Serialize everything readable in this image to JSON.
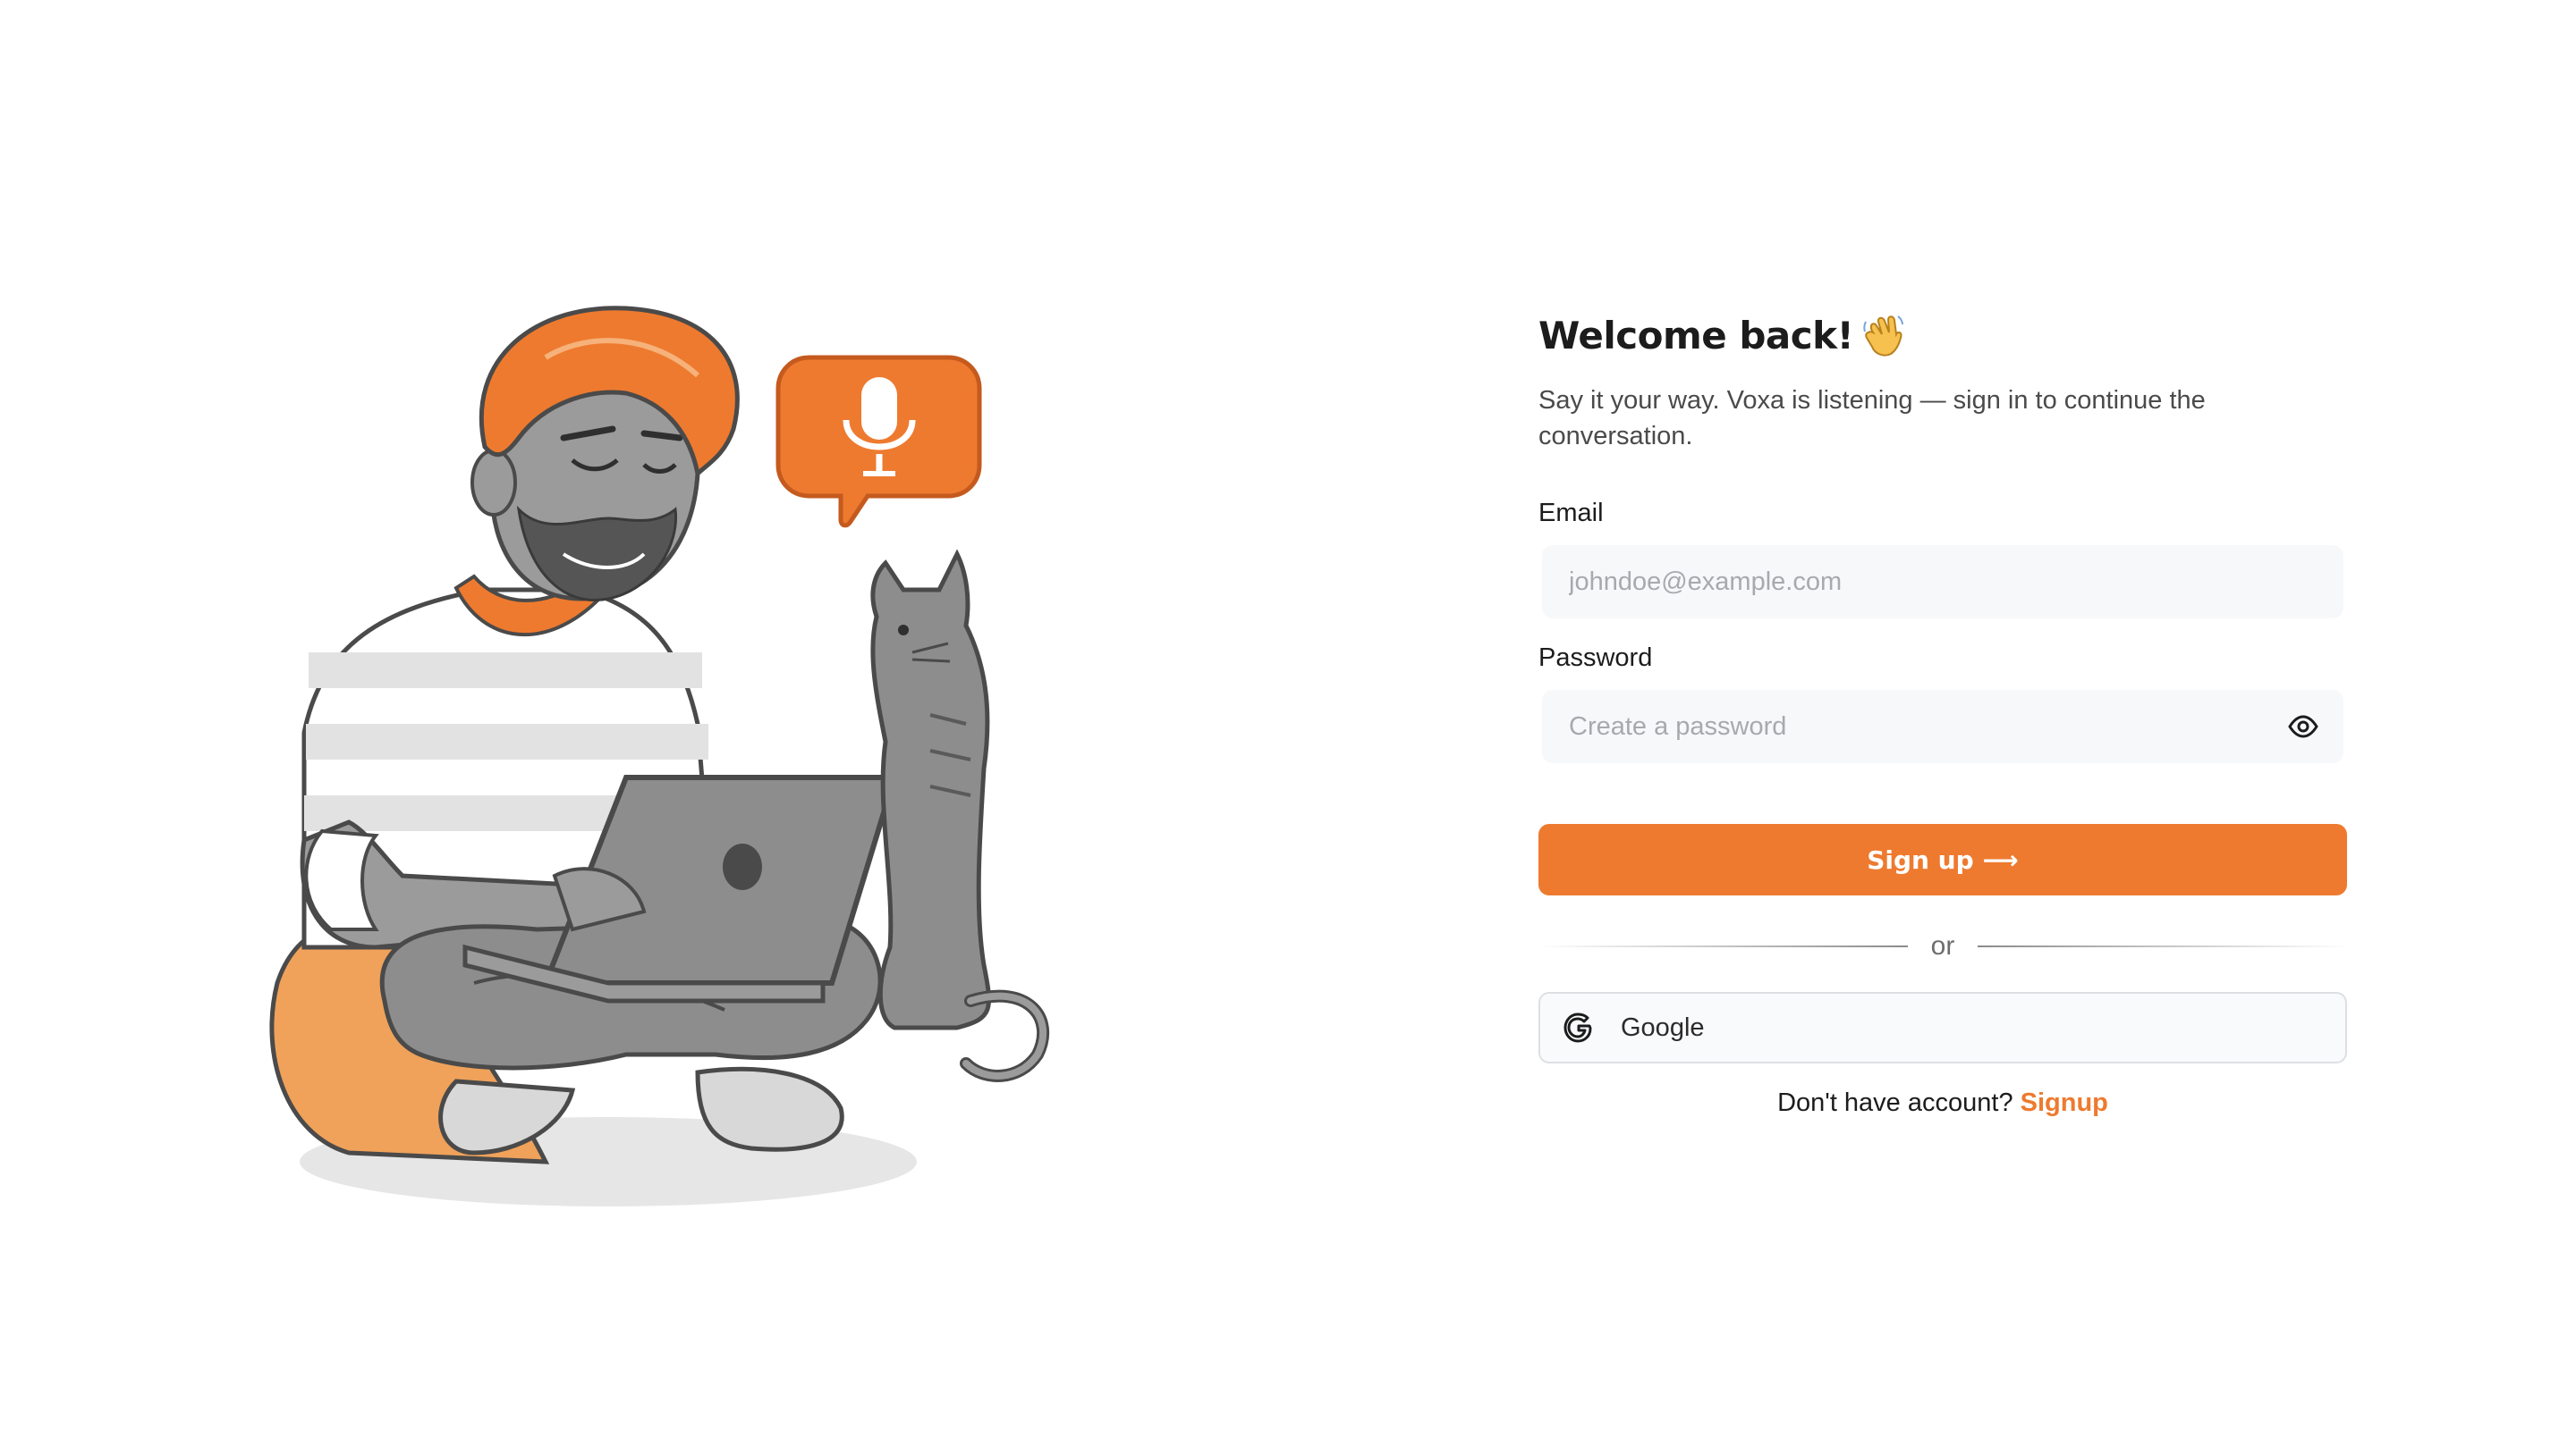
{
  "form": {
    "title": "Welcome back!",
    "subtitle": "Say it your way. Voxa is listening — sign in to continue the conversation.",
    "email": {
      "label": "Email",
      "placeholder": "johndoe@example.com",
      "value": ""
    },
    "password": {
      "label": "Password",
      "placeholder": "Create a password",
      "value": ""
    },
    "submit_label": "Sign up",
    "submit_arrow": "⟶",
    "divider_text": "or",
    "google_label": "Google",
    "footer": {
      "prompt": "Don't have account?",
      "link_label": "Signup"
    }
  },
  "icons": {
    "title_emoji": "waving-hand-icon",
    "password_toggle": "eye-icon",
    "google": "google-icon",
    "speech_bubble": "microphone-icon"
  },
  "colors": {
    "accent": "#ee7a2f",
    "input_bg": "#f7f8fa",
    "text": "#1c1c1c",
    "muted": "#4a4a4a",
    "placeholder": "#a7a9ad"
  }
}
